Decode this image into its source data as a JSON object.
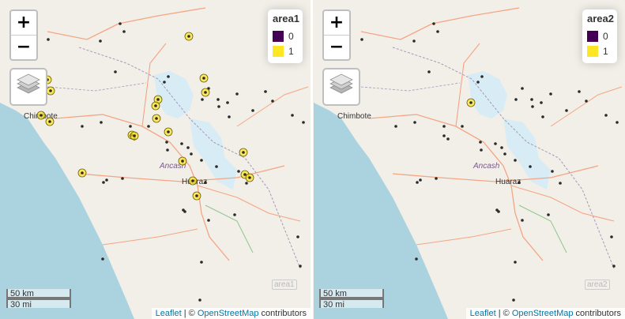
{
  "maps": [
    {
      "id": "left",
      "legend": {
        "title": "area1",
        "items": [
          {
            "label": "0",
            "color": "#440154"
          },
          {
            "label": "1",
            "color": "#fde725"
          }
        ]
      },
      "places": {
        "city1": "Chimbote",
        "city2": "Huaraz",
        "region": "Ancash"
      },
      "controls": {
        "zoom_in": "+",
        "zoom_out": "−"
      },
      "scale": {
        "metric": "50 km",
        "imperial": "30 mi"
      },
      "attribution": {
        "leaflet": "Leaflet",
        "sep": " | © ",
        "osm": "OpenStreetMap",
        "rest": " contributors"
      },
      "watermark": "area1"
    },
    {
      "id": "right",
      "legend": {
        "title": "area2",
        "items": [
          {
            "label": "0",
            "color": "#440154"
          },
          {
            "label": "1",
            "color": "#fde725"
          }
        ]
      },
      "places": {
        "city1": "Chimbote",
        "city2": "Huaraz",
        "region": "Ancash"
      },
      "controls": {
        "zoom_in": "+",
        "zoom_out": "−"
      },
      "scale": {
        "metric": "50 km",
        "imperial": "30 mi"
      },
      "attribution": {
        "leaflet": "Leaflet",
        "sep": " | © ",
        "osm": "OpenStreetMap",
        "rest": " contributors"
      },
      "watermark": "area2"
    }
  ],
  "colors": {
    "land": "#f2efe9",
    "sea": "#aad3df",
    "glacier": "#d8ecf5",
    "road": "#f4a582",
    "boundary": "#a898b8",
    "marker_zero": "#440154",
    "marker_one": "#fde725"
  }
}
